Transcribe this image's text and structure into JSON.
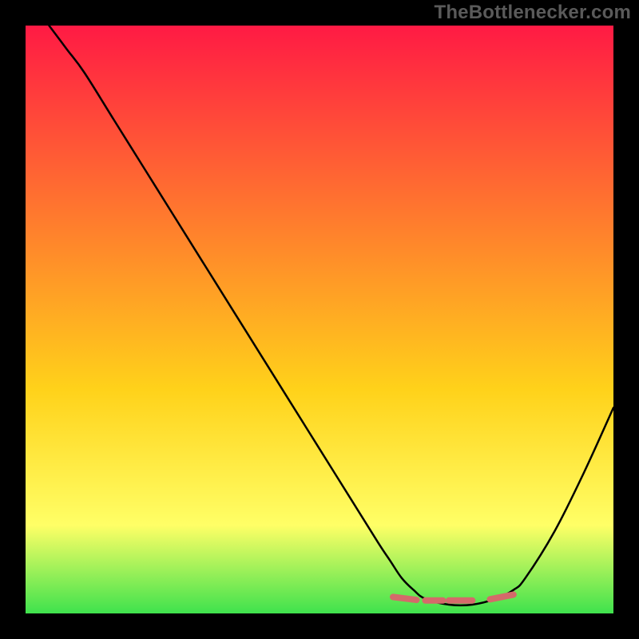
{
  "watermark": "TheBottlenecker.com",
  "colors": {
    "black": "#000000",
    "curve": "#000000",
    "highlight": "#d46a6a",
    "gradient_top": "#ff1a44",
    "gradient_mid1": "#ff8a2a",
    "gradient_mid2": "#ffd21a",
    "gradient_mid3": "#ffff66",
    "gradient_bottom": "#3fe24d"
  },
  "chart_data": {
    "type": "line",
    "title": "",
    "xlabel": "",
    "ylabel": "",
    "xlim": [
      0,
      100
    ],
    "ylim": [
      0,
      100
    ],
    "series": [
      {
        "name": "main-curve",
        "x": [
          4,
          7,
          10,
          15,
          20,
          25,
          30,
          35,
          40,
          45,
          50,
          55,
          60,
          62,
          64,
          66,
          68,
          72,
          76,
          80,
          83,
          85,
          90,
          95,
          100
        ],
        "y": [
          100,
          96,
          92,
          84,
          76,
          68,
          60,
          52,
          44,
          36,
          28,
          20,
          12,
          9,
          6,
          4,
          2.5,
          1.5,
          1.5,
          2.5,
          4,
          6,
          14,
          24,
          35
        ]
      }
    ],
    "highlighted_segments": [
      {
        "x": [
          62.5,
          66.5
        ],
        "y": [
          2.8,
          2.3
        ]
      },
      {
        "x": [
          68.0,
          71.0
        ],
        "y": [
          2.2,
          2.2
        ]
      },
      {
        "x": [
          72.0,
          76.0
        ],
        "y": [
          2.2,
          2.2
        ]
      },
      {
        "x": [
          79.0,
          83.0
        ],
        "y": [
          2.4,
          3.2
        ]
      }
    ]
  }
}
